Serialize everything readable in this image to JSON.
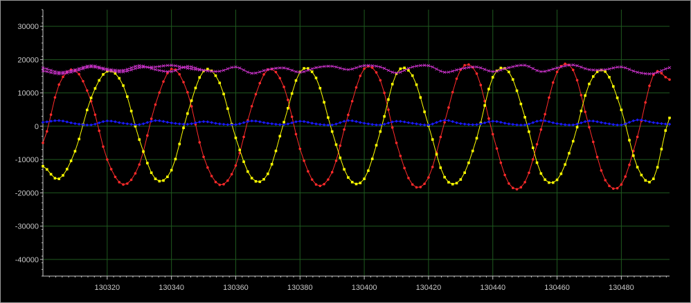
{
  "chart_data": {
    "type": "line",
    "title": "",
    "xlabel": "",
    "ylabel": "",
    "xlim": [
      130300,
      130495
    ],
    "ylim": [
      -45000,
      35000
    ],
    "x_ticks": [
      130320,
      130340,
      130360,
      130380,
      130400,
      130420,
      130440,
      130460,
      130480
    ],
    "y_ticks": [
      30000,
      20000,
      10000,
      0,
      -10000,
      -20000,
      -30000,
      -40000
    ],
    "x_tick_labels": [
      "130320",
      "130340",
      "130360",
      "130380",
      "130400",
      "130420",
      "130440",
      "130460",
      "130480"
    ],
    "y_tick_labels": [
      "30000",
      "20000",
      "10000",
      "0",
      "-10000",
      "-20000",
      "-30000",
      "-40000"
    ],
    "grid": true,
    "legend": "none",
    "colors": {
      "background": "#000000",
      "grid": "#1f5a1f",
      "axis": "#c8c8c8",
      "frame": "#9a9a9a"
    },
    "series": [
      {
        "color": "#ff2a2a",
        "marker": "circle",
        "x": [
          130300,
          130305,
          130310,
          130315,
          130320,
          130325,
          130330,
          130335,
          130340,
          130345,
          130350,
          130355,
          130360,
          130365,
          130370,
          130375,
          130380,
          130385,
          130390,
          130395,
          130400,
          130405,
          130410,
          130415,
          130420,
          130425,
          130430,
          130435,
          130440,
          130445,
          130450,
          130455,
          130460,
          130465,
          130470,
          130475,
          130480,
          130485,
          130490,
          130495
        ],
        "values": [
          -5000,
          12500,
          16800,
          7500,
          -10000,
          -17500,
          -11500,
          6500,
          17200,
          10200,
          -9200,
          -17600,
          -11800,
          6000,
          17000,
          11800,
          -6800,
          -17500,
          -13800,
          3400,
          17300,
          13800,
          -5000,
          -17500,
          -15400,
          1200,
          17000,
          15800,
          -2400,
          -17200,
          -16800,
          -1000,
          16300,
          16900,
          -300,
          -16200,
          -17500,
          -3200,
          15500,
          14000
        ]
      },
      {
        "color": "#ffff00",
        "marker": "square",
        "x": [
          130300,
          130305,
          130310,
          130315,
          130320,
          130325,
          130330,
          130335,
          130340,
          130345,
          130350,
          130355,
          130360,
          130365,
          130370,
          130375,
          130380,
          130385,
          130390,
          130395,
          130400,
          130405,
          130410,
          130415,
          130420,
          130425,
          130430,
          130435,
          130440,
          130445,
          130450,
          130455,
          130460,
          130465,
          130470,
          130475,
          130480,
          130485,
          130490,
          130495
        ],
        "values": [
          -12000,
          -15800,
          -7500,
          8500,
          16500,
          12200,
          -4000,
          -15800,
          -13200,
          3800,
          16600,
          13000,
          -3500,
          -15600,
          -14300,
          1200,
          16300,
          14500,
          -1600,
          -15400,
          -15800,
          -1600,
          15800,
          15200,
          200,
          -15300,
          -16000,
          -3600,
          14700,
          16300,
          2700,
          -14200,
          -16100,
          -4500,
          12700,
          16400,
          4900,
          -12300,
          -15800,
          2500
        ]
      },
      {
        "color": "#1a1aff",
        "marker": "diamond",
        "x": [
          130300,
          130305,
          130310,
          130315,
          130320,
          130325,
          130330,
          130335,
          130340,
          130345,
          130350,
          130355,
          130360,
          130365,
          130370,
          130375,
          130380,
          130385,
          130390,
          130395,
          130400,
          130405,
          130410,
          130415,
          130420,
          130425,
          130430,
          130435,
          130440,
          130445,
          130450,
          130455,
          130460,
          130465,
          130470,
          130475,
          130480,
          130485,
          130490,
          130495
        ],
        "values": [
          1200,
          1700,
          800,
          400,
          1600,
          900,
          500,
          1700,
          1000,
          600,
          1400,
          700,
          500,
          1600,
          900,
          500,
          1500,
          700,
          400,
          1700,
          900,
          400,
          1500,
          900,
          400,
          1800,
          800,
          500,
          1500,
          700,
          400,
          1700,
          800,
          400,
          1600,
          900,
          400,
          1900,
          1100,
          600
        ]
      },
      {
        "color": "#cc33cc",
        "marker": "cross",
        "x": [
          130300,
          130305,
          130310,
          130315,
          130320,
          130325,
          130330,
          130335,
          130340,
          130345,
          130350,
          130355,
          130360,
          130365,
          130370,
          130375,
          130380,
          130385,
          130390,
          130395,
          130400,
          130405,
          130410,
          130415,
          130420,
          130425,
          130430,
          130435,
          130440,
          130445,
          130450,
          130455,
          130460,
          130465,
          130470,
          130475,
          130480,
          130485,
          130490,
          130495
        ],
        "values": [
          17500,
          16200,
          17000,
          18200,
          17200,
          16800,
          18200,
          17000,
          16400,
          18000,
          16800,
          16500,
          17800,
          15900,
          17000,
          17500,
          16200,
          17600,
          18000,
          17000,
          18200,
          17800,
          16000,
          17800,
          18200,
          16200,
          17200,
          17800,
          16400,
          17600,
          18300,
          16400,
          17500,
          18400,
          17000,
          17000,
          17800,
          16200,
          15800,
          17600
        ]
      },
      {
        "color": "#cc33cc",
        "marker": "cross",
        "x": [
          130300,
          130305,
          130310,
          130315,
          130320,
          130325,
          130330,
          130335,
          130340,
          130345,
          130350
        ],
        "values": [
          16600,
          15700,
          16500,
          17800,
          16800,
          16300,
          17600,
          17800,
          18300,
          17400,
          16800
        ]
      }
    ]
  }
}
